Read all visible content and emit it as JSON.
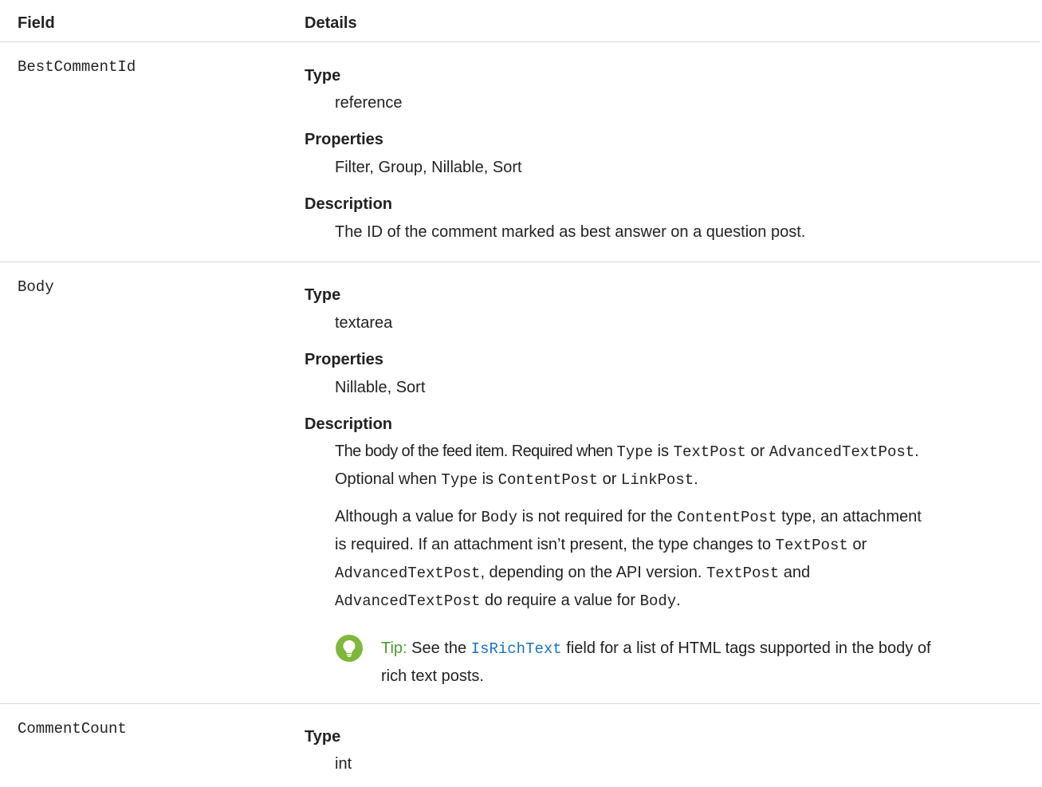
{
  "header": {
    "col_field": "Field",
    "col_details": "Details"
  },
  "labels": {
    "type": "Type",
    "properties": "Properties",
    "description": "Description"
  },
  "rows": [
    {
      "field": "BestCommentId",
      "type": "reference",
      "properties": "Filter, Group, Nillable, Sort",
      "description": "The ID of the comment marked as best answer on a question post."
    },
    {
      "field": "Body",
      "type": "textarea",
      "properties": "Nillable, Sort",
      "desc": {
        "p1l1_a": "The body of the feed item. Required when ",
        "p1l1_code1": "Type",
        "p1l1_b": " is ",
        "p1l1_code2": "TextPost",
        "p1l1_c": " or ",
        "p1l1_code3": "AdvancedTextPost",
        "p1l1_d": ".",
        "p1l2_a": "Optional when ",
        "p1l2_code1": "Type",
        "p1l2_b": " is ",
        "p1l2_code2": "ContentPost",
        "p1l2_c": " or ",
        "p1l2_code3": "LinkPost",
        "p1l2_d": ".",
        "p2l1_a": "Although a value for ",
        "p2l1_code1": "Body",
        "p2l1_b": " is not required for the ",
        "p2l1_code2": "ContentPost",
        "p2l1_c": " type, an attachment",
        "p2l2_a": "is required. If an attachment isn’t present, the type changes to ",
        "p2l2_code1": "TextPost",
        "p2l2_b": " or",
        "p2l3_code1": "AdvancedTextPost",
        "p2l3_a": ", depending on the API version. ",
        "p2l3_code2": "TextPost",
        "p2l3_b": " and",
        "p2l4_code1": "AdvancedTextPost",
        "p2l4_a": " do require a value for ",
        "p2l4_code2": "Body",
        "p2l4_b": "."
      },
      "tip": {
        "label": "Tip:",
        "text_a": " See the ",
        "link": "IsRichText",
        "text_b": " field for a list of HTML tags supported in the body of",
        "text_c": "rich text posts.",
        "icon": "lightbulb-icon",
        "icon_color": "#7fb83a"
      }
    },
    {
      "field": "CommentCount",
      "type": "int"
    }
  ]
}
